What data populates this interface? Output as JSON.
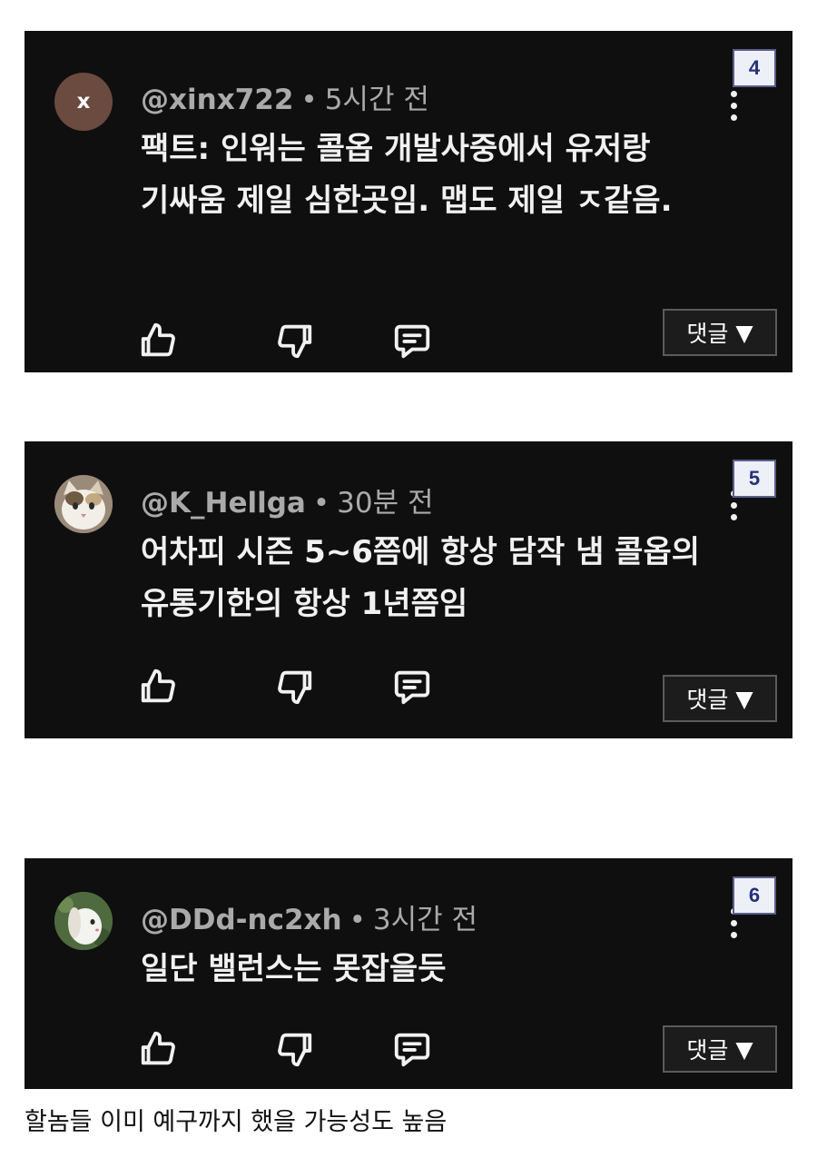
{
  "comments": [
    {
      "handle": "@xinx722",
      "separator": "•",
      "time": "5시간 전",
      "avatar_letter": "x",
      "avatar_color": "#6b4a40",
      "text": "팩트: 인워는 콜옵 개발사중에서 유저랑 기싸움 제일 심한곳임. 맵도 제일 ㅈ같음.",
      "number": "4",
      "reply_label": "댓글",
      "reply_arrow": "▼"
    },
    {
      "handle": "@K_Hellga",
      "separator": "•",
      "time": "30분 전",
      "avatar_letter": "",
      "avatar_color": "#8a7a6a",
      "text": "어차피 시즌 5~6쯤에 항상 담작 냄 콜옵의 유통기한의 항상 1년쯤임",
      "number": "5",
      "reply_label": "댓글",
      "reply_arrow": "▼"
    },
    {
      "handle": "@DDd-nc2xh",
      "separator": "•",
      "time": "3시간 전",
      "avatar_letter": "",
      "avatar_color": "#4f6a3e",
      "text": "일단 밸런스는 못잡을듯",
      "number": "6",
      "reply_label": "댓글",
      "reply_arrow": "▼"
    }
  ],
  "icons": {
    "like": "thumbs-up-icon",
    "dislike": "thumbs-down-icon",
    "reply": "comment-icon",
    "menu": "more-vertical-icon"
  },
  "caption": "할놈들 이미 예구까지 했을 가능성도 높음"
}
